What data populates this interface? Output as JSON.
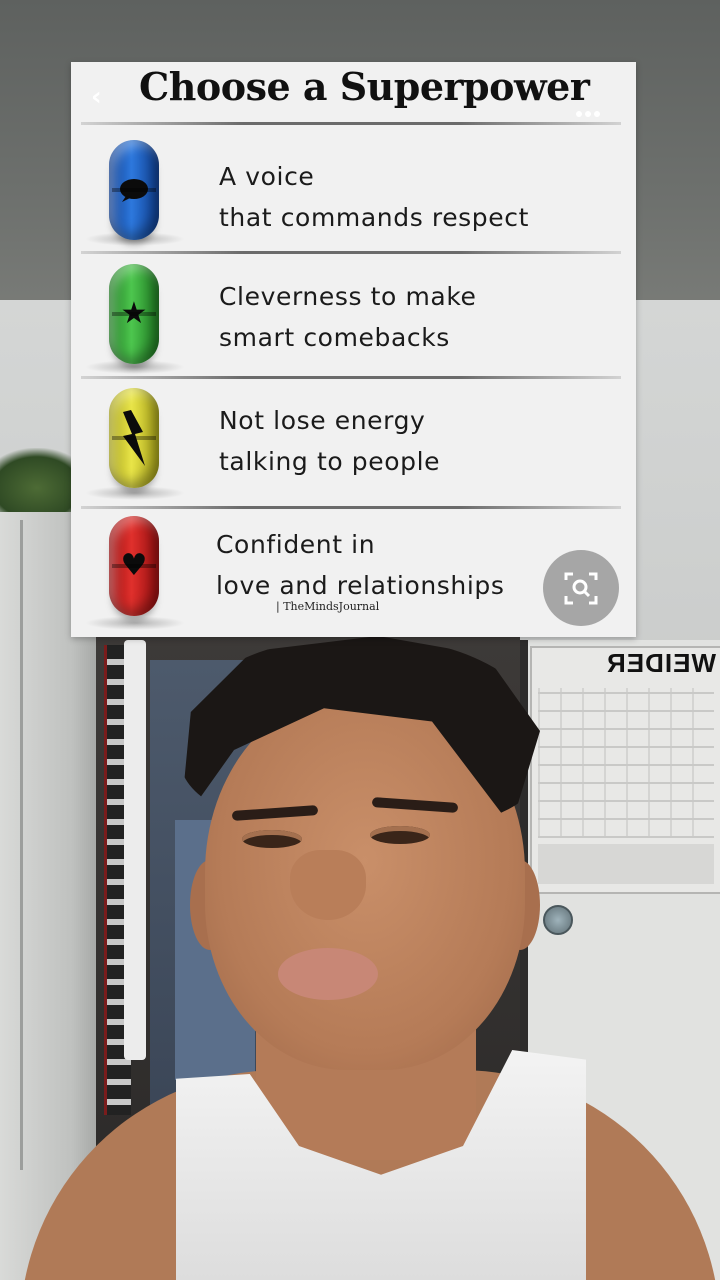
{
  "card": {
    "title": "Choose a Superpower",
    "back_icon": "chevron-left-icon",
    "more_icon": "more-dots-icon"
  },
  "options": [
    {
      "color": "#2d78dd",
      "icon": "speech-bubble-icon",
      "line1": "A voice",
      "line2": "that commands respect"
    },
    {
      "color": "#4dc64e",
      "icon": "star-icon",
      "line1": "Cleverness to make",
      "line2": "smart comebacks"
    },
    {
      "color": "#e9e548",
      "icon": "lightning-icon",
      "line1": "Not lose energy",
      "line2": "talking to people"
    },
    {
      "color": "#e0302c",
      "icon": "heart-icon",
      "line1": "Confident in",
      "line2": "love and relationships"
    }
  ],
  "watermark": "| TheMindsJournal",
  "visual_search_icon": "image-search-icon",
  "poster_heading": "WEIDER"
}
